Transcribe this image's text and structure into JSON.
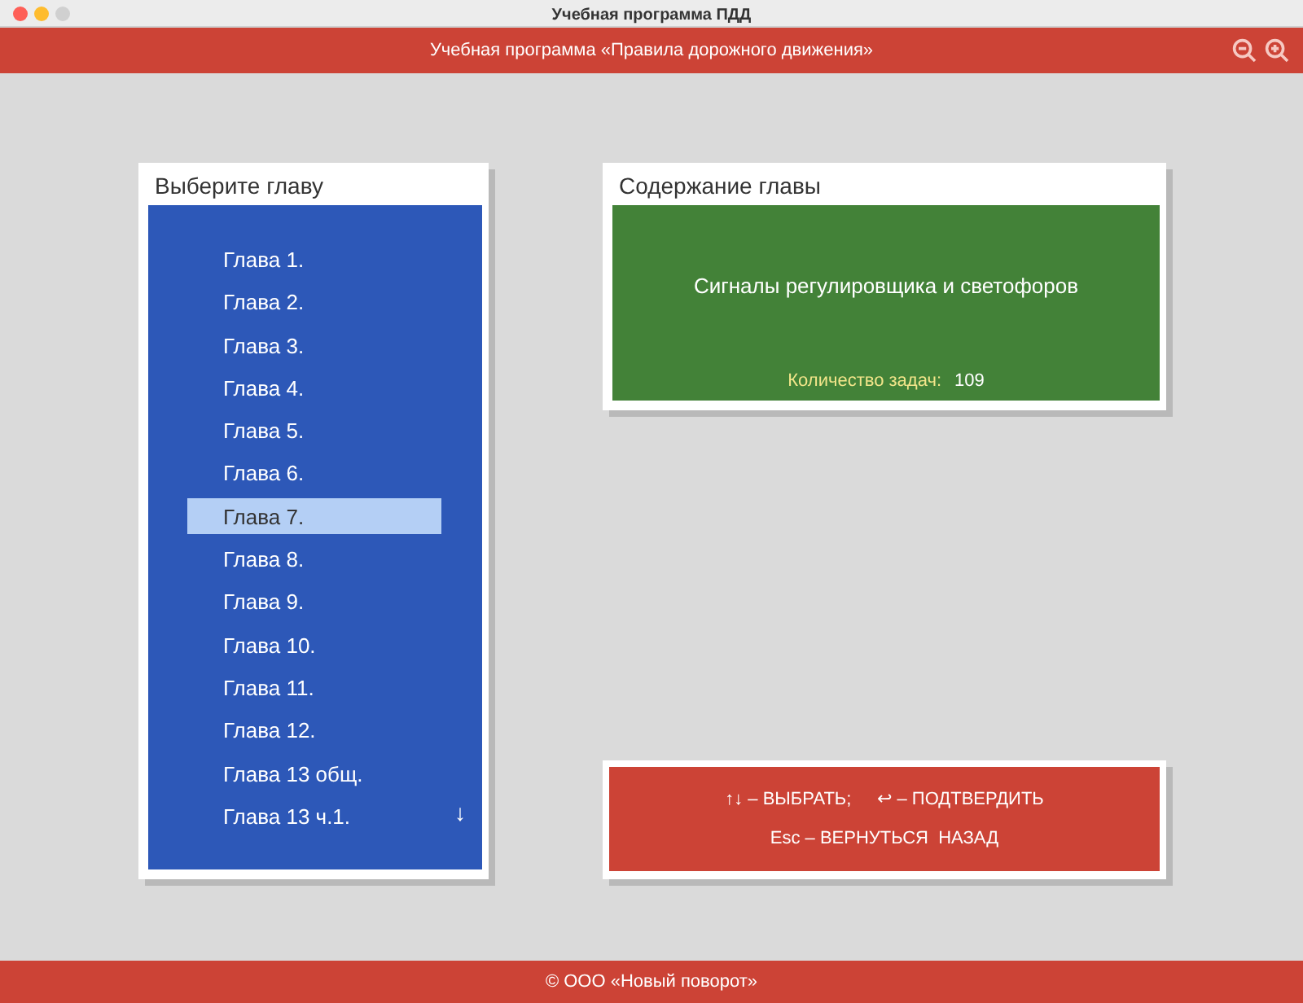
{
  "window": {
    "title": "Учебная программа ПДД"
  },
  "header": {
    "title": "Учебная программа «Правила дорожного движения»",
    "buttons": [
      {
        "kind": "zoom-out"
      },
      {
        "kind": "zoom-in"
      }
    ]
  },
  "chapter_list": {
    "title": "Выберите главу",
    "items": [
      {
        "label": "Глава 1.",
        "selected": false
      },
      {
        "label": "Глава 2.",
        "selected": false
      },
      {
        "label": "Глава 3.",
        "selected": false
      },
      {
        "label": "Глава 4.",
        "selected": false
      },
      {
        "label": "Глава 5.",
        "selected": false
      },
      {
        "label": "Глава 6.",
        "selected": false
      },
      {
        "label": "Глава 7.",
        "selected": true
      },
      {
        "label": "Глава 8.",
        "selected": false
      },
      {
        "label": "Глава 9.",
        "selected": false
      },
      {
        "label": "Глава 10.",
        "selected": false
      },
      {
        "label": "Глава 11.",
        "selected": false
      },
      {
        "label": "Глава 12.",
        "selected": false
      },
      {
        "label": "Глава 13 общ.",
        "selected": false
      },
      {
        "label": "Глава 13 ч.1.",
        "selected": false
      }
    ],
    "more_indicator": "↓"
  },
  "chapter_content": {
    "title": "Содержание главы",
    "name": "Сигналы регулировщика и светофоров",
    "task_count_label": "Количество задач:",
    "task_count": "109"
  },
  "hints": [
    [
      "↑↓ – ВЫБРАТЬ;",
      "↩ – ПОДТВЕРДИТЬ"
    ],
    [
      "Esc – ВЕРНУТЬСЯ  НАЗАД"
    ]
  ],
  "footer": "© ООО «Новый поворот»"
}
